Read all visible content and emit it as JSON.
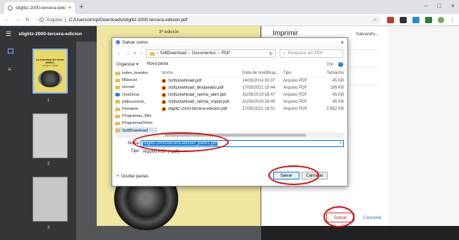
{
  "browser": {
    "tab_title": "stiglitz-2000-tercera-edicion.pdf",
    "tab_close": "×",
    "new_tab": "+",
    "win_min": "–",
    "win_max": "□",
    "win_close": "×",
    "back": "←",
    "forward": "→",
    "reload": "↻",
    "address_prefix": "Arquivo",
    "address_sep": "|",
    "address_url": "C:/Users/srmp/Downloads/stiglitz-2000-tercera-edicion.pdf"
  },
  "pdf": {
    "title": "stiglitz-2000-tercera-edicion",
    "page_header": "3ª edición",
    "thumb_cover_title": "La economía del sector público",
    "thumb_cover_author": "Joseph E. Stiglitz",
    "thumb_numbers": [
      "1",
      "2",
      "3"
    ]
  },
  "print_panel": {
    "title": "Imprimir",
    "status": "Salvando...",
    "save_label": "Salvar",
    "cancel_label": "Cancelar"
  },
  "dialog": {
    "title": "Salvar como",
    "close": "×",
    "path": [
      "SoftDownload",
      "Documentos",
      "PDF"
    ],
    "search_placeholder": "Pesquisar em PDF",
    "organize": "Organizar ▾",
    "new_folder": "Nova pasta",
    "sidebar": [
      {
        "label": "index_leandro",
        "icon": "folder-icon"
      },
      {
        "label": "Músicas",
        "icon": "folder-icon"
      },
      {
        "label": "nircmd",
        "icon": "folder-icon"
      },
      {
        "label": "OneDrive",
        "icon": "cloud-icon"
      },
      {
        "label": "pfdocument_",
        "icon": "folder-icon"
      },
      {
        "label": "Portateis",
        "icon": "folder-icon"
      },
      {
        "label": "Programas_Win",
        "icon": "folder-icon"
      },
      {
        "label": "ProgramasDeInc",
        "icon": "folder-icon"
      },
      {
        "label": "SoftDownload",
        "icon": "folder-icon"
      }
    ],
    "columns": [
      "Nome",
      "Data de modificaç...",
      "Tipo",
      "Tamanho"
    ],
    "files": [
      {
        "name": "SoftDownload.pdf",
        "date": "14/05/2014 00:07",
        "type": "Arquivo PDF",
        "size": "45 KB"
      },
      {
        "name": "SoftDownload_bloqueado.pdf",
        "date": "17/05/2021 15:44",
        "type": "Arquivo PDF",
        "size": "195 KB"
      },
      {
        "name": "SoftDownload_senha_abrir.pdf",
        "date": "31/08/2019 16:47",
        "type": "Arquivo PDF",
        "size": "45 KB"
      },
      {
        "name": "SoftDownload_senha_copiar.pdf",
        "date": "31/08/2019 16:48",
        "type": "Arquivo PDF",
        "size": "45 KB"
      },
      {
        "name": "stiglitz-2000-tercera-edicion.pdf",
        "date": "27/05/2022 16:52",
        "type": "Arquivo PDF",
        "size": "2.652 KB"
      }
    ],
    "name_label": "Nome:",
    "name_value": "stiglitz-2000-tercera-edicion_parte1.pdf",
    "type_label": "Tipo:",
    "type_value": "Arquivo PDF (*.pdf)",
    "hide_folders": "Ocultar pastas",
    "save_label": "Salvar",
    "cancel_label": "Cancelar"
  },
  "colors": {
    "accent": "#0078d7",
    "annotation": "#e00000",
    "page_bg": "#efe6a0"
  }
}
